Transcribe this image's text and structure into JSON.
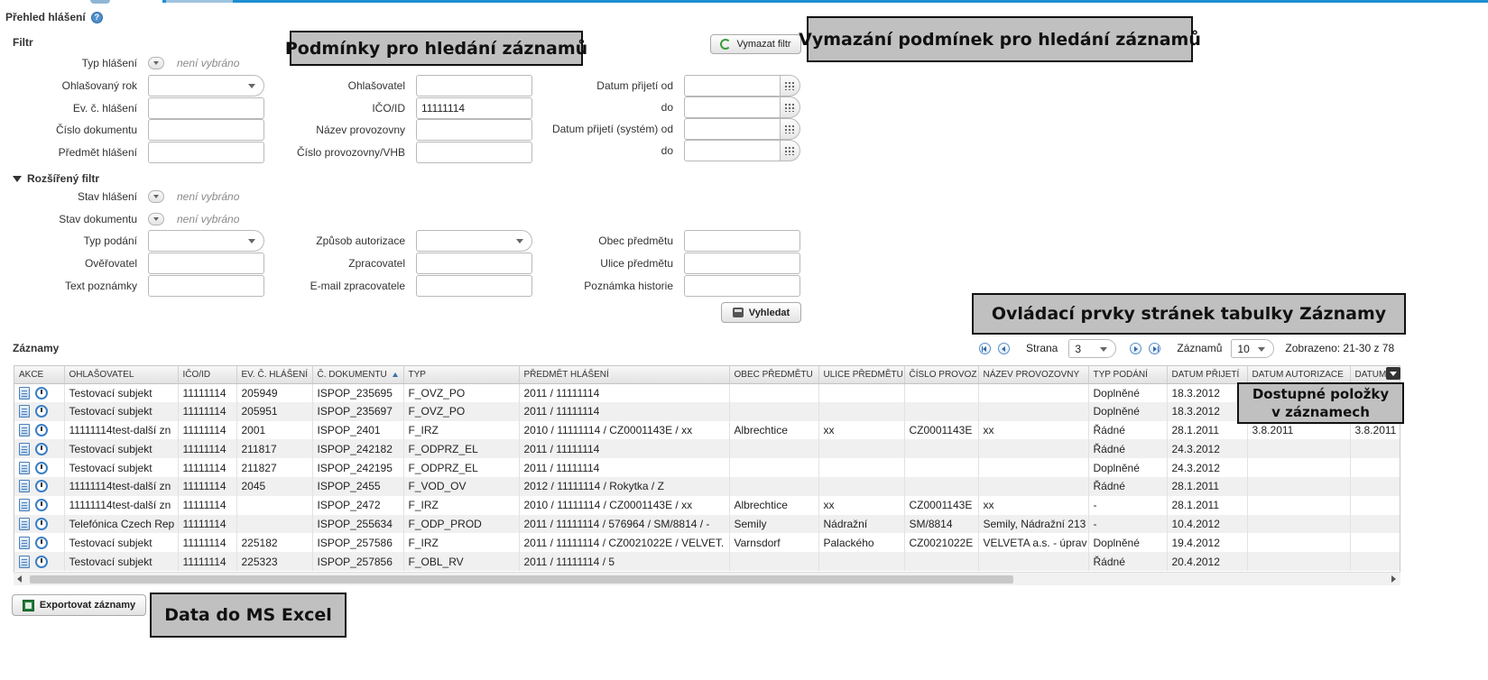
{
  "page": {
    "title": "Přehled hlášení"
  },
  "filter": {
    "title": "Filtr",
    "clear_button": "Vymazat filtr",
    "labels": {
      "typ_hlaseni": "Typ hlášení",
      "ohlasovany_rok": "Ohlašovaný rok",
      "ev_c_hlaseni": "Ev. č. hlášení",
      "cislo_dokumentu": "Číslo dokumentu",
      "predmet_hlaseni": "Předmět hlášení",
      "ohlasovatel": "Ohlašovatel",
      "ico_id": "IČO/ID",
      "nazev_provozovny": "Název provozovny",
      "cislo_provozovny": "Číslo provozovny/VHB",
      "datum_prijeti_od": "Datum přijetí od",
      "do1": "do",
      "datum_prijeti_system_od": "Datum přijetí (systém) od",
      "do2": "do"
    },
    "not_selected": "není vybráno",
    "values": {
      "ico_id": "11111114"
    }
  },
  "extended_filter": {
    "title": "Rozšířený filtr",
    "labels": {
      "stav_hlaseni": "Stav hlášení",
      "stav_dokumentu": "Stav dokumentu",
      "typ_podani": "Typ podání",
      "overovatel": "Ověřovatel",
      "text_poznamky": "Text poznámky",
      "zpusob_autorizace": "Způsob autorizace",
      "zpracovatel": "Zpracovatel",
      "email_zpracovatele": "E-mail zpracovatele",
      "obec_predmetu": "Obec předmětu",
      "ulice_predmetu": "Ulice předmětu",
      "poznamka_historie": "Poznámka historie"
    },
    "not_selected": "není vybráno",
    "search_button": "Vyhledat"
  },
  "records": {
    "title": "Záznamy",
    "pager": {
      "page_label": "Strana",
      "page_value": "3",
      "count_label": "Záznamů",
      "count_value": "10",
      "shown": "Zobrazeno: 21-30 z 78"
    },
    "columns": [
      "AKCE",
      "OHLAŠOVATEL",
      "IČO/ID",
      "EV. Č. HLÁŠENÍ",
      "Č. DOKUMENTU",
      "TYP",
      "PŘEDMĚT HLÁŠENÍ",
      "OBEC PŘEDMĚTU",
      "ULICE PŘEDMĚTU",
      "ČÍSLO PROVOZ",
      "NÁZEV PROVOZOVNY",
      "TYP PODÁNÍ",
      "DATUM PŘIJETÍ",
      "DATUM AUTORIZACE",
      "DATUM"
    ],
    "rows": [
      [
        "",
        "Testovací subjekt",
        "11111114",
        "205949",
        "ISPOP_235695",
        "F_OVZ_PO",
        "2011 / 11111114",
        "",
        "",
        "",
        "",
        "Doplněné",
        "18.3.2012",
        "",
        ""
      ],
      [
        "",
        "Testovací subjekt",
        "11111114",
        "205951",
        "ISPOP_235697",
        "F_OVZ_PO",
        "2011 / 11111114",
        "",
        "",
        "",
        "",
        "Doplněné",
        "18.3.2012",
        "",
        ""
      ],
      [
        "",
        "11111114test-další zn",
        "11111114",
        "2001",
        "ISPOP_2401",
        "F_IRZ",
        "2010 / 11111114 / CZ0001143E / xx",
        "Albrechtice",
        "xx",
        "CZ0001143E",
        "xx",
        "Řádné",
        "28.1.2011",
        "3.8.2011",
        "3.8.2011"
      ],
      [
        "",
        "Testovací subjekt",
        "11111114",
        "211817",
        "ISPOP_242182",
        "F_ODPRZ_EL",
        "2011 / 11111114",
        "",
        "",
        "",
        "",
        "Řádné",
        "24.3.2012",
        "",
        ""
      ],
      [
        "",
        "Testovací subjekt",
        "11111114",
        "211827",
        "ISPOP_242195",
        "F_ODPRZ_EL",
        "2011 / 11111114",
        "",
        "",
        "",
        "",
        "Doplněné",
        "24.3.2012",
        "",
        ""
      ],
      [
        "",
        "11111114test-další zn",
        "11111114",
        "2045",
        "ISPOP_2455",
        "F_VOD_OV",
        "2012 / 11111114 / Rokytka / Z",
        "",
        "",
        "",
        "",
        "Řádné",
        "28.1.2011",
        "",
        ""
      ],
      [
        "",
        "11111114test-další zn",
        "11111114",
        "",
        "ISPOP_2472",
        "F_IRZ",
        "2010 / 11111114 / CZ0001143E / xx",
        "Albrechtice",
        "xx",
        "CZ0001143E",
        "xx",
        "-",
        "28.1.2011",
        "",
        ""
      ],
      [
        "",
        "Telefónica Czech Rep",
        "11111114",
        "",
        "ISPOP_255634",
        "F_ODP_PROD",
        "2011 / 11111114 / 576964 / SM/8814 / -",
        "Semily",
        "Nádražní",
        "SM/8814",
        "Semily, Nádražní 213",
        "-",
        "10.4.2012",
        "",
        ""
      ],
      [
        "",
        "Testovací subjekt",
        "11111114",
        "225182",
        "ISPOP_257586",
        "F_IRZ",
        "2011 / 11111114 / CZ0021022E / VELVET.",
        "Varnsdorf",
        "Palackého",
        "CZ0021022E",
        "VELVETA a.s. - úprav",
        "Doplněné",
        "19.4.2012",
        "",
        ""
      ],
      [
        "",
        "Testovací subjekt",
        "11111114",
        "225323",
        "ISPOP_257856",
        "F_OBL_RV",
        "2011 / 11111114 / 5",
        "",
        "",
        "",
        "",
        "Řádné",
        "20.4.2012",
        "",
        ""
      ]
    ],
    "export_button": "Exportovat záznamy"
  },
  "callouts": {
    "conditions": "Podmínky pro hledání záznamů",
    "clear_conditions": "Vymazání podmínek pro hledání záznamů",
    "pager_controls": "Ovládací prvky stránek tabulky Záznamy",
    "available_items_line1": "Dostupné položky",
    "available_items_line2": "v záznamech",
    "excel": "Data do MS Excel"
  },
  "colors": {
    "accent": "#1d8fd1",
    "callout_bg": "#c0c0c0"
  }
}
